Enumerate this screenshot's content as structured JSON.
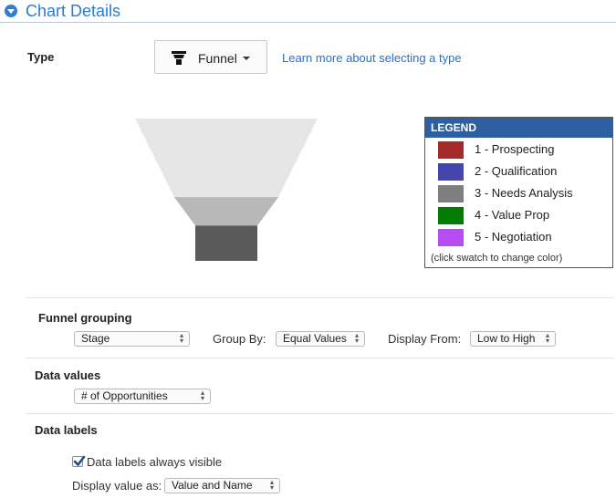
{
  "header": {
    "title": "Chart Details"
  },
  "type_row": {
    "label": "Type",
    "selected": "Funnel",
    "learn_link": "Learn more about selecting a type"
  },
  "chart_data": {
    "type": "funnel",
    "stages": [
      {
        "label": "1 - Prospecting",
        "value": 5.8,
        "color": "#e6e6e6"
      },
      {
        "label": "2 - Qualification",
        "value": 2.1,
        "color": "#b8b8b8"
      },
      {
        "label": "3 - Needs Analysis",
        "value": 2.6,
        "color": "#5a5a5a"
      }
    ]
  },
  "legend": {
    "title": "LEGEND",
    "items": [
      {
        "label": "1 - Prospecting",
        "color": "#a52a2a"
      },
      {
        "label": "2 - Qualification",
        "color": "#4545b0"
      },
      {
        "label": "3 - Needs Analysis",
        "color": "#7d807d"
      },
      {
        "label": "4 - Value Prop",
        "color": "#037a03"
      },
      {
        "label": "5 - Negotiation",
        "color": "#b84cf5"
      }
    ],
    "note": "(click swatch to change color)"
  },
  "funnel_grouping": {
    "title": "Funnel grouping",
    "stage_select": "Stage",
    "group_by_label": "Group By:",
    "group_by_value": "Equal Values",
    "display_from_label": "Display From:",
    "display_from_value": "Low to High"
  },
  "data_values": {
    "title": "Data values",
    "select": "# of Opportunities"
  },
  "data_labels": {
    "title": "Data labels",
    "checkbox_label": "Data labels always visible",
    "checked": true,
    "display_as_label": "Display value as:",
    "display_as_value": "Value and Name"
  }
}
